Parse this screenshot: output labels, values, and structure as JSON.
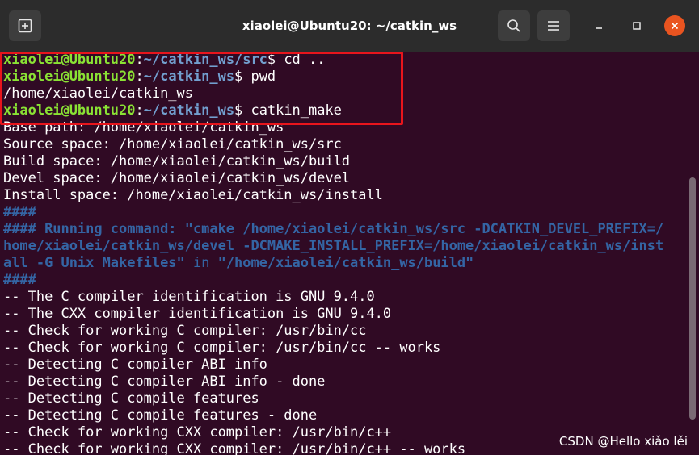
{
  "titlebar": {
    "title": "xiaolei@Ubuntu20: ~/catkin_ws",
    "new_tab_icon": "new-tab-icon",
    "search_icon": "search-icon",
    "menu_icon": "hamburger-menu-icon",
    "minimize_icon": "minimize-icon",
    "maximize_icon": "maximize-icon",
    "close_icon": "close-icon"
  },
  "colors": {
    "background": "#300a24",
    "prompt_user": "#8ae234",
    "prompt_path": "#729fcf",
    "comment_blue": "#3465a4",
    "highlight": "#e8151c",
    "close_button": "#e95420"
  },
  "terminal": {
    "prompts": [
      {
        "user": "xiaolei@Ubuntu20",
        "sep": ":",
        "path": "~/catkin_ws/src",
        "sym": "$",
        "cmd": " cd .."
      },
      {
        "user": "xiaolei@Ubuntu20",
        "sep": ":",
        "path": "~/catkin_ws",
        "sym": "$",
        "cmd": " pwd"
      },
      {
        "user": "xiaolei@Ubuntu20",
        "sep": ":",
        "path": "~/catkin_ws",
        "sym": "$",
        "cmd": " catkin_make"
      }
    ],
    "pwd_output": "/home/xiaolei/catkin_ws",
    "base_path": "Base path: /home/xiaolei/catkin_ws",
    "source_space": "Source space: /home/xiaolei/catkin_ws/src",
    "build_space": "Build space: /home/xiaolei/catkin_ws/build",
    "devel_space": "Devel space: /home/xiaolei/catkin_ws/devel",
    "install_space": "Install space: /home/xiaolei/catkin_ws/install",
    "hash_1": "####",
    "running_line_1": "#### Running command: \"cmake /home/xiaolei/catkin_ws/src -DCATKIN_DEVEL_PREFIX=/",
    "running_line_2": "home/xiaolei/catkin_ws/devel -DCMAKE_INSTALL_PREFIX=/home/xiaolei/catkin_ws/inst",
    "running_line_3a": "all -G Unix Makefiles\"",
    "running_line_3b": " in ",
    "running_line_3c": "\"/home/xiaolei/catkin_ws/build\"",
    "hash_2": "####",
    "output_lines": [
      "-- The C compiler identification is GNU 9.4.0",
      "-- The CXX compiler identification is GNU 9.4.0",
      "-- Check for working C compiler: /usr/bin/cc",
      "-- Check for working C compiler: /usr/bin/cc -- works",
      "-- Detecting C compiler ABI info",
      "-- Detecting C compiler ABI info - done",
      "-- Detecting C compile features",
      "-- Detecting C compile features - done",
      "-- Check for working CXX compiler: /usr/bin/c++",
      "-- Check for working CXX compiler: /usr/bin/c++ -- works"
    ]
  },
  "watermark": "CSDN @Hello xiǎo lěi"
}
